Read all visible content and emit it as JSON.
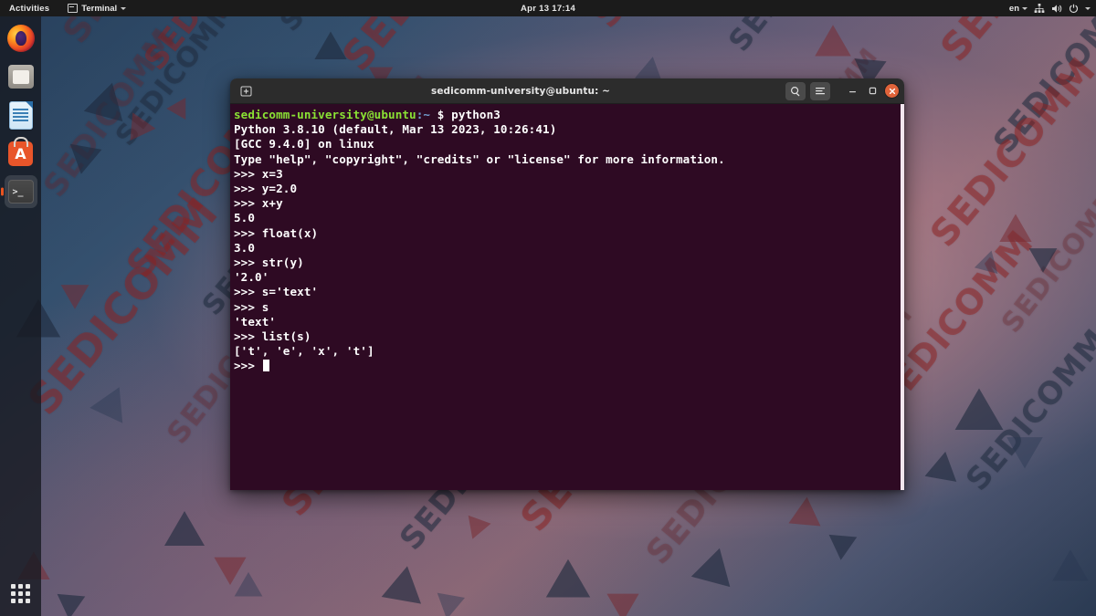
{
  "topbar": {
    "activities": "Activities",
    "app_menu": "Terminal",
    "clock": "Apr 13  17:14",
    "language": "en",
    "icons": [
      "network-icon",
      "volume-icon",
      "power-icon",
      "chevron-down-icon"
    ]
  },
  "dock": {
    "items": [
      {
        "name": "firefox",
        "label": "Firefox"
      },
      {
        "name": "files",
        "label": "Files"
      },
      {
        "name": "libreoffice-writer",
        "label": "LibreOffice Writer"
      },
      {
        "name": "ubuntu-software",
        "label": "Ubuntu Software",
        "glyph": "A"
      },
      {
        "name": "terminal",
        "label": "Terminal",
        "glyph": ">_",
        "active": true
      }
    ],
    "show_applications": "Show Applications"
  },
  "terminal": {
    "title": "sedicomm-university@ubuntu: ~",
    "titlebar_buttons": {
      "new_tab": "new-tab-icon",
      "search": "search-icon",
      "menu": "hamburger-menu-icon",
      "minimize": "minimize-icon",
      "maximize": "maximize-icon",
      "close": "close-icon"
    },
    "prompt": {
      "user_host": "sedicomm-university@ubuntu",
      "path": ":~",
      "symbol": "$",
      "command": "python3"
    },
    "lines": [
      "Python 3.8.10 (default, Mar 13 2023, 10:26:41)",
      "[GCC 9.4.0] on linux",
      "Type \"help\", \"copyright\", \"credits\" or \"license\" for more information.",
      ">>> x=3",
      ">>> y=2.0",
      ">>> x+y",
      "5.0",
      ">>> float(x)",
      "3.0",
      ">>> str(y)",
      "'2.0'",
      ">>> s='text'",
      ">>> s",
      "'text'",
      ">>> list(s)",
      "['t', 'e', 'x', 't']"
    ],
    "final_prompt": ">>> ",
    "colors": {
      "background": "#2e0a23",
      "titlebar": "#2c2c2c",
      "prompt_user": "#8ae234",
      "prompt_path": "#729fcf",
      "text": "#ffffff",
      "close_button": "#e0633a"
    }
  },
  "wallpaper": {
    "brand_text": "SEDICOMM",
    "colors": {
      "accent_red": "#962323",
      "accent_dark": "#233044"
    }
  }
}
